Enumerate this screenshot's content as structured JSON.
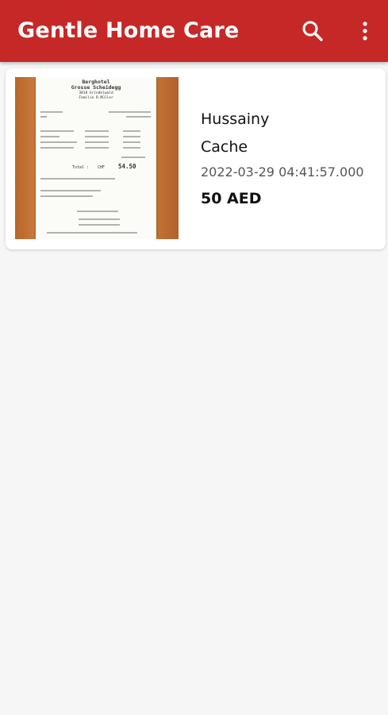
{
  "app_bar": {
    "title": "Gentle Home Care",
    "actions": [
      {
        "icon": "search-icon"
      },
      {
        "icon": "more-vert-icon"
      }
    ],
    "background_color": "#c62828"
  },
  "expenses": [
    {
      "name": "Hussainy",
      "payment_method": "Cache",
      "datetime": "2022-03-29 04:41:57.000",
      "amount": "50 AED",
      "receipt": {
        "header_lines": [
          "Berghotel",
          "Grosse Scheidegg",
          "3818 Grindelwald",
          "Familie R.Müller"
        ],
        "total_label": "Total :",
        "total_currency": "CHF",
        "total_value": "54.50"
      }
    }
  ]
}
